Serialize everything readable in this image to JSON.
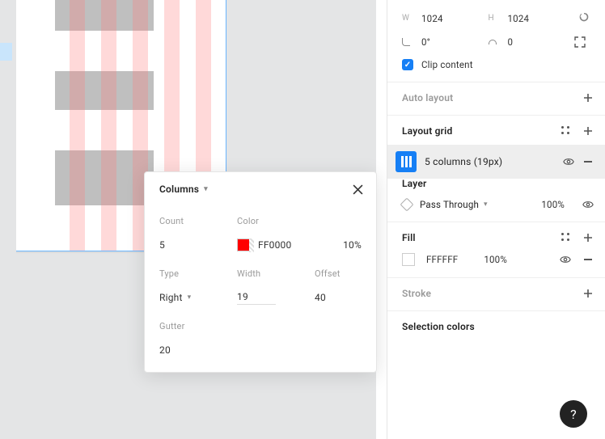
{
  "inspector": {
    "size": {
      "w_label": "W",
      "w_value": "1024",
      "h_label": "H",
      "h_value": "1024",
      "rotation": "0°",
      "corner_radius": "0"
    },
    "clip_content": "Clip content",
    "auto_layout": "Auto layout",
    "layout_grid": {
      "title": "Layout grid",
      "item": "5 columns (19px)"
    },
    "layer": {
      "title": "Layer",
      "blend": "Pass Through",
      "opacity": "100%"
    },
    "fill": {
      "title": "Fill",
      "hex": "FFFFFF",
      "opacity": "100%"
    },
    "stroke": {
      "title": "Stroke"
    },
    "selection_colors": {
      "title": "Selection colors"
    }
  },
  "popover": {
    "title": "Columns",
    "count_label": "Count",
    "count_value": "5",
    "color_label": "Color",
    "color_hex": "FF0000",
    "color_opacity": "10%",
    "type_label": "Type",
    "type_value": "Right",
    "width_label": "Width",
    "width_value": "19",
    "offset_label": "Offset",
    "offset_value": "40",
    "gutter_label": "Gutter",
    "gutter_value": "20"
  },
  "help": "?"
}
